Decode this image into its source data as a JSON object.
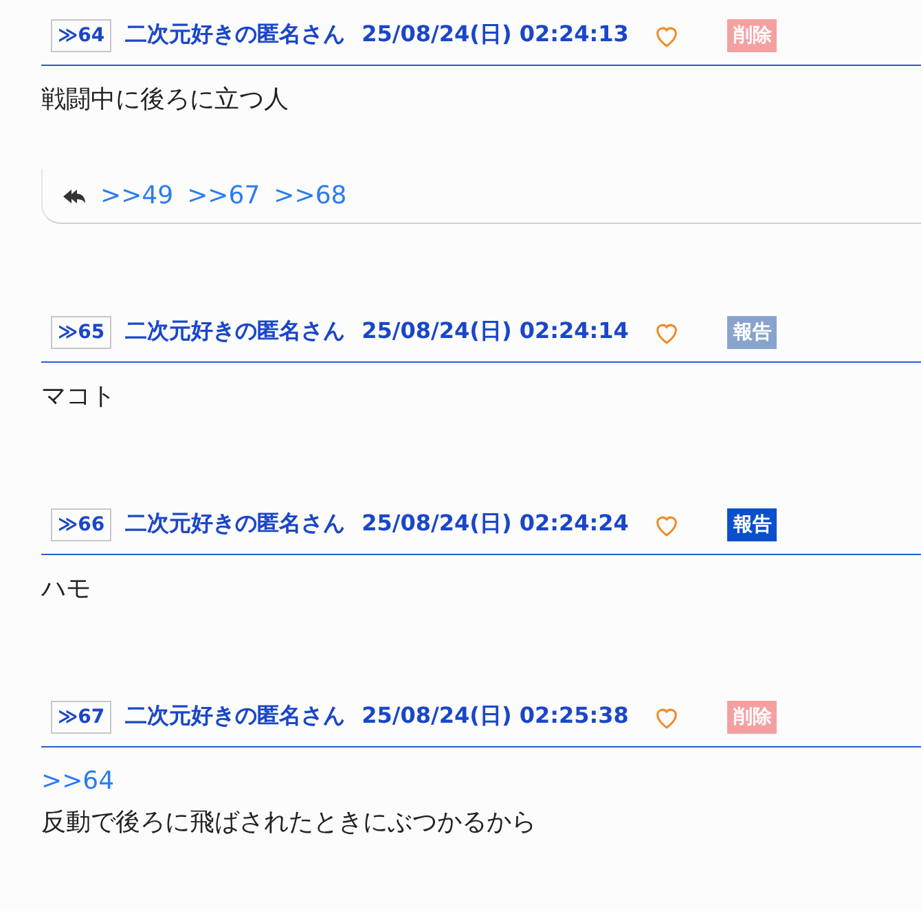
{
  "posts": [
    {
      "number": "≫64",
      "name": "二次元好きの匿名さん",
      "date": "25/08/24(日) 02:24:13",
      "liked": false,
      "badge": {
        "label": "削除",
        "color": "#f5a0a0"
      },
      "body": [
        {
          "kind": "text",
          "text": "戦闘中に後ろに立つ人"
        }
      ],
      "replies": [
        ">>49",
        ">>67",
        ">>68"
      ]
    },
    {
      "number": "≫65",
      "name": "二次元好きの匿名さん",
      "date": "25/08/24(日) 02:24:14",
      "liked": false,
      "badge": {
        "label": "報告",
        "color": "#88a4cc"
      },
      "body": [
        {
          "kind": "text",
          "text": "マコト"
        }
      ]
    },
    {
      "number": "≫66",
      "name": "二次元好きの匿名さん",
      "date": "25/08/24(日) 02:24:24",
      "liked": false,
      "badge": {
        "label": "報告",
        "color": "#0b4fcc"
      },
      "body": [
        {
          "kind": "text",
          "text": "ハモ"
        }
      ]
    },
    {
      "number": "≫67",
      "name": "二次元好きの匿名さん",
      "date": "25/08/24(日) 02:25:38",
      "liked": false,
      "badge": {
        "label": "削除",
        "color": "#f5a0a0"
      },
      "body": [
        {
          "kind": "anchor",
          "text": ">>64"
        },
        {
          "kind": "text",
          "text": "反動で後ろに飛ばされたときにぶつかるから"
        }
      ]
    }
  ]
}
